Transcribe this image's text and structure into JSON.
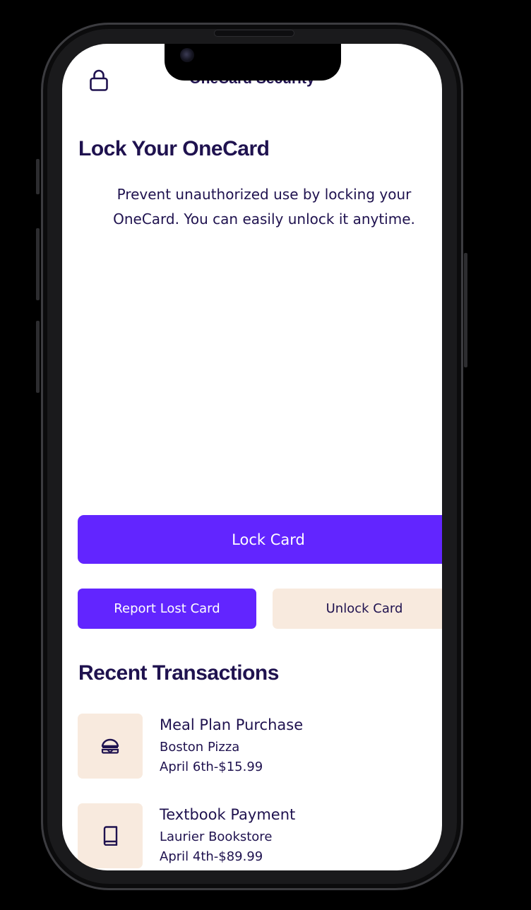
{
  "header": {
    "title": "OneCard Security",
    "icon": "lock-icon"
  },
  "hero": {
    "title": "Lock Your OneCard",
    "description": "Prevent unauthorized use by locking your OneCard. You can easily unlock it anytime."
  },
  "actions": {
    "lock_label": "Lock Card",
    "report_label": "Report Lost Card",
    "unlock_label": "Unlock Card"
  },
  "transactions": {
    "title": "Recent Transactions",
    "items": [
      {
        "title": "Meal Plan Purchase",
        "merchant": "Boston Pizza",
        "date": "April 6th",
        "separator": "-",
        "amount": "$15.99",
        "icon": "food-icon"
      },
      {
        "title": "Textbook Payment",
        "merchant": "Laurier Bookstore",
        "date": "April 4th",
        "separator": "-",
        "amount": "$89.99",
        "icon": "book-icon"
      }
    ]
  },
  "colors": {
    "primary": "#6225ff",
    "text": "#1f124f",
    "secondary_bg": "#f8eade"
  }
}
